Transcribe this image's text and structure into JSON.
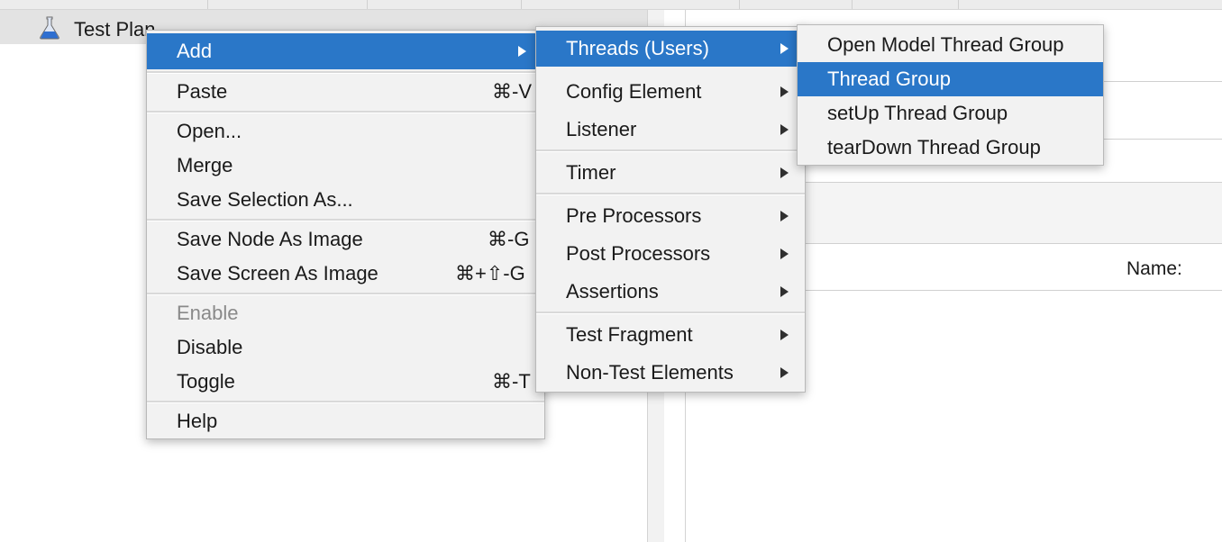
{
  "tree": {
    "root_label": "Test Plan"
  },
  "right_panel": {
    "name_label": "Name:"
  },
  "context_menu": {
    "items": [
      {
        "label": "Add",
        "shortcut": "",
        "has_submenu": true
      },
      {
        "label": "Paste",
        "shortcut": "⌘-V"
      },
      {
        "label": "Open...",
        "shortcut": ""
      },
      {
        "label": "Merge",
        "shortcut": ""
      },
      {
        "label": "Save Selection As...",
        "shortcut": ""
      },
      {
        "label": "Save Node As Image",
        "shortcut": "⌘-G"
      },
      {
        "label": "Save Screen As Image",
        "shortcut": "⌘+⇧-G"
      },
      {
        "label": "Enable",
        "shortcut": "",
        "disabled": true
      },
      {
        "label": "Disable",
        "shortcut": ""
      },
      {
        "label": "Toggle",
        "shortcut": "⌘-T"
      },
      {
        "label": "Help",
        "shortcut": ""
      }
    ],
    "highlighted": "Add"
  },
  "add_submenu": {
    "items": [
      {
        "label": "Threads (Users)"
      },
      {
        "label": "Config Element"
      },
      {
        "label": "Listener"
      },
      {
        "label": "Timer"
      },
      {
        "label": "Pre Processors"
      },
      {
        "label": "Post Processors"
      },
      {
        "label": "Assertions"
      },
      {
        "label": "Test Fragment"
      },
      {
        "label": "Non-Test Elements"
      }
    ],
    "highlighted": "Threads (Users)"
  },
  "threads_submenu": {
    "items": [
      {
        "label": "Open Model Thread Group"
      },
      {
        "label": "Thread Group"
      },
      {
        "label": "setUp Thread Group"
      },
      {
        "label": "tearDown Thread Group"
      }
    ],
    "highlighted": "Thread Group"
  },
  "colors": {
    "highlight": "#2a77c8",
    "menu_bg": "#f2f2f2",
    "disabled_text": "#8a8a8a",
    "icon_blue": "#2f6fd0"
  }
}
